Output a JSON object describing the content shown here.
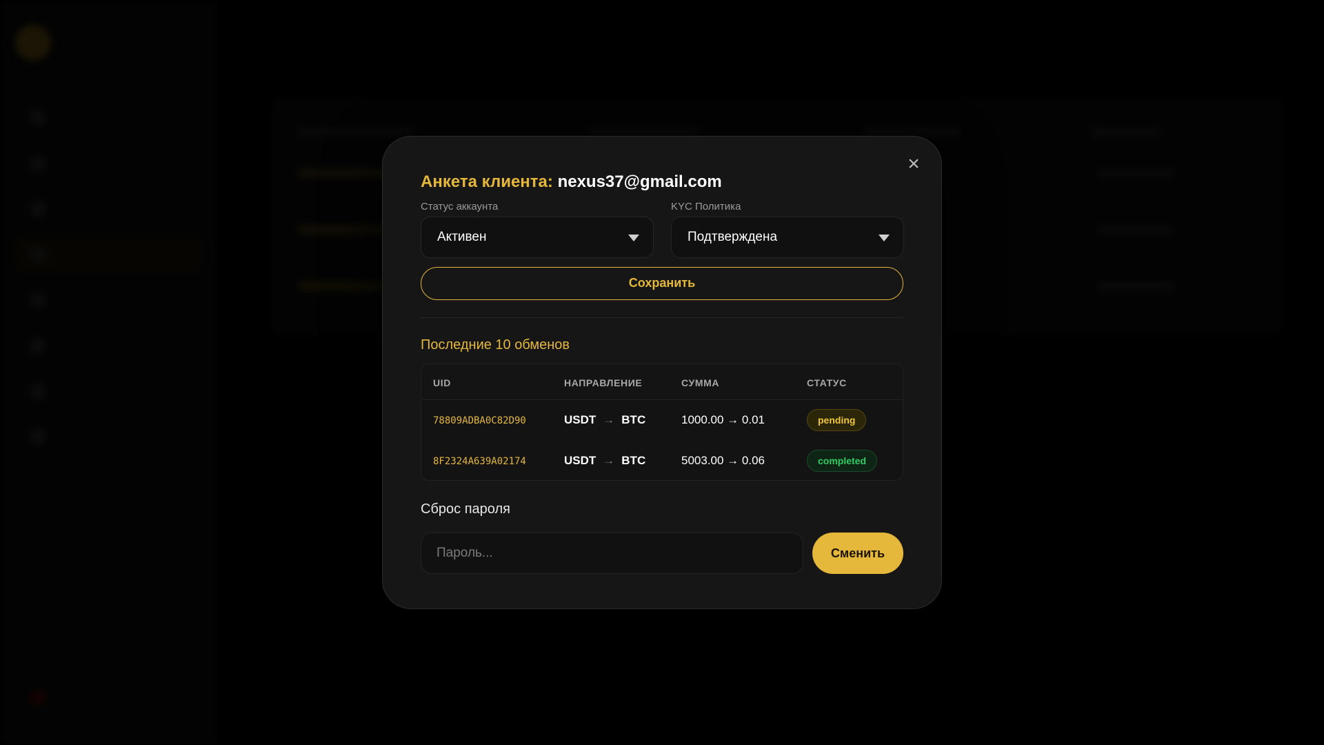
{
  "modal": {
    "title_label": "Анкета клиента:",
    "title_email": "nexus37@gmail.com",
    "account_status": {
      "label": "Статус аккаунта",
      "value": "Активен"
    },
    "kyc_policy": {
      "label": "KYC Политика",
      "value": "Подтверждена"
    },
    "save_label": "Сохранить",
    "exchanges": {
      "title": "Последние 10 обменов",
      "columns": [
        "UID",
        "НАПРАВЛЕНИЕ",
        "СУММА",
        "СТАТУС"
      ],
      "rows": [
        {
          "uid": "78809ADBA0C82D90",
          "from": "USDT",
          "arrow": "→",
          "to": "BTC",
          "amount": "1000.00 → 0.01",
          "status": "pending"
        },
        {
          "uid": "8F2324A639A02174",
          "from": "USDT",
          "arrow": "→",
          "to": "BTC",
          "amount": "5003.00 → 0.06",
          "status": "completed"
        }
      ]
    },
    "password_reset": {
      "title": "Сброс пароля",
      "placeholder": "Пароль...",
      "button": "Сменить"
    },
    "close_symbol": "×"
  },
  "colors": {
    "accent": "#e5b73b",
    "pending": "#f1c63a",
    "completed": "#2ecc63",
    "modal_bg": "#161616"
  }
}
